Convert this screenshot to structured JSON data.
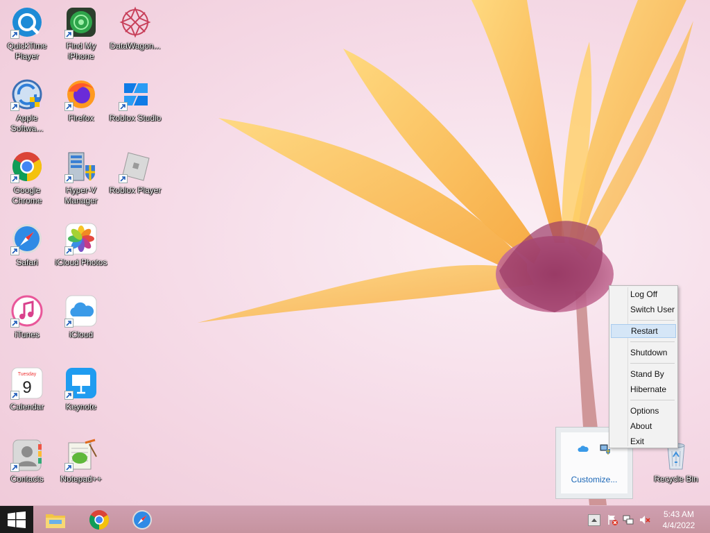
{
  "desktop": {
    "icons": [
      {
        "label": "QuickTime Player",
        "icon": "quicktime-icon"
      },
      {
        "label": "Find My iPhone",
        "icon": "find-my-iphone-icon"
      },
      {
        "label": "DataWagon...",
        "icon": "datawagon-icon"
      },
      {
        "label": "Apple Softwa...",
        "icon": "apple-software-update-icon"
      },
      {
        "label": "Firefox",
        "icon": "firefox-icon"
      },
      {
        "label": "Roblox Studio",
        "icon": "roblox-studio-icon"
      },
      {
        "label": "Google Chrome",
        "icon": "chrome-icon"
      },
      {
        "label": "Hyper-V Manager",
        "icon": "hyperv-manager-icon"
      },
      {
        "label": "Roblox Player",
        "icon": "roblox-player-icon"
      },
      {
        "label": "Safari",
        "icon": "safari-icon"
      },
      {
        "label": "iCloud Photos",
        "icon": "icloud-photos-icon"
      },
      {
        "label": "iTunes",
        "icon": "itunes-icon"
      },
      {
        "label": "iCloud",
        "icon": "icloud-icon"
      },
      {
        "label": "Calendar",
        "icon": "calendar-icon",
        "badge_day": "Tuesday",
        "badge_date": "9"
      },
      {
        "label": "Keynote",
        "icon": "keynote-icon"
      },
      {
        "label": "Contacts",
        "icon": "contacts-icon"
      },
      {
        "label": "Notepad++",
        "icon": "notepadpp-icon"
      },
      {
        "label": "Recycle Bin",
        "icon": "recycle-bin-icon"
      }
    ]
  },
  "power_menu": {
    "items": [
      "Log Off",
      "Switch User",
      "Restart",
      "Shutdown",
      "Stand By",
      "Hibernate",
      "Options",
      "About",
      "Exit"
    ],
    "highlighted": "Restart"
  },
  "tray_flyout": {
    "customize_label": "Customize...",
    "icons": [
      "icloud-icon",
      "network-shield-icon"
    ]
  },
  "taskbar": {
    "pinned": [
      "file-explorer-icon",
      "chrome-icon",
      "safari-icon"
    ],
    "tray_icons": [
      "action-center-flag-icon",
      "network-icon",
      "volume-muted-icon"
    ],
    "clock": {
      "time": "5:43 AM",
      "date": "4/4/2022"
    }
  },
  "colors": {
    "accent": "#1a66b6",
    "taskbar": "#c6939f",
    "menu_highlight": "#d5e6f7"
  }
}
